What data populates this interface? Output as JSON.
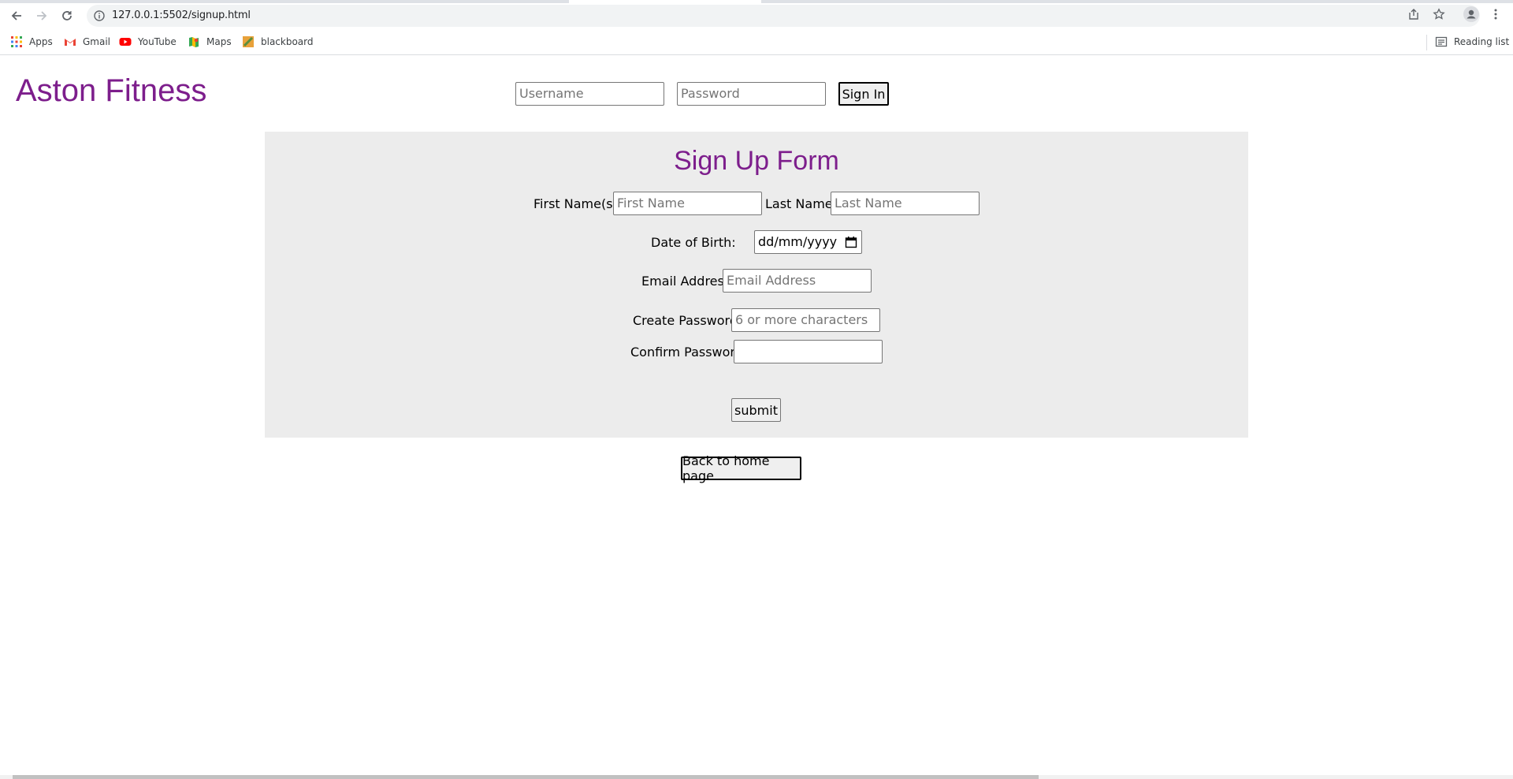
{
  "browser": {
    "url": "127.0.0.1:5502/signup.html",
    "bookmarks": [
      "Apps",
      "Gmail",
      "YouTube",
      "Maps",
      "blackboard"
    ],
    "reading_list": "Reading list"
  },
  "header": {
    "brand": "Aston Fitness",
    "username_placeholder": "Username",
    "password_placeholder": "Password",
    "sign_in_label": "Sign In"
  },
  "form": {
    "title": "Sign Up Form",
    "first_name_label": "First Name(s):",
    "first_name_placeholder": "First Name",
    "last_name_label": "Last Name:",
    "last_name_placeholder": "Last Name",
    "dob_label": "Date of Birth:",
    "dob_value": "dd/mm/yyyy",
    "email_label": "Email Address",
    "email_placeholder": "Email Address",
    "create_password_label": "Create Password:",
    "create_password_placeholder": "6 or more characters",
    "confirm_password_label": "Confirm Password",
    "confirm_password_value": "",
    "submit_label": "submit"
  },
  "footer": {
    "back_label": "Back to home page"
  },
  "colors": {
    "brand": "#7d1e8c",
    "form_bg": "#ececec"
  }
}
